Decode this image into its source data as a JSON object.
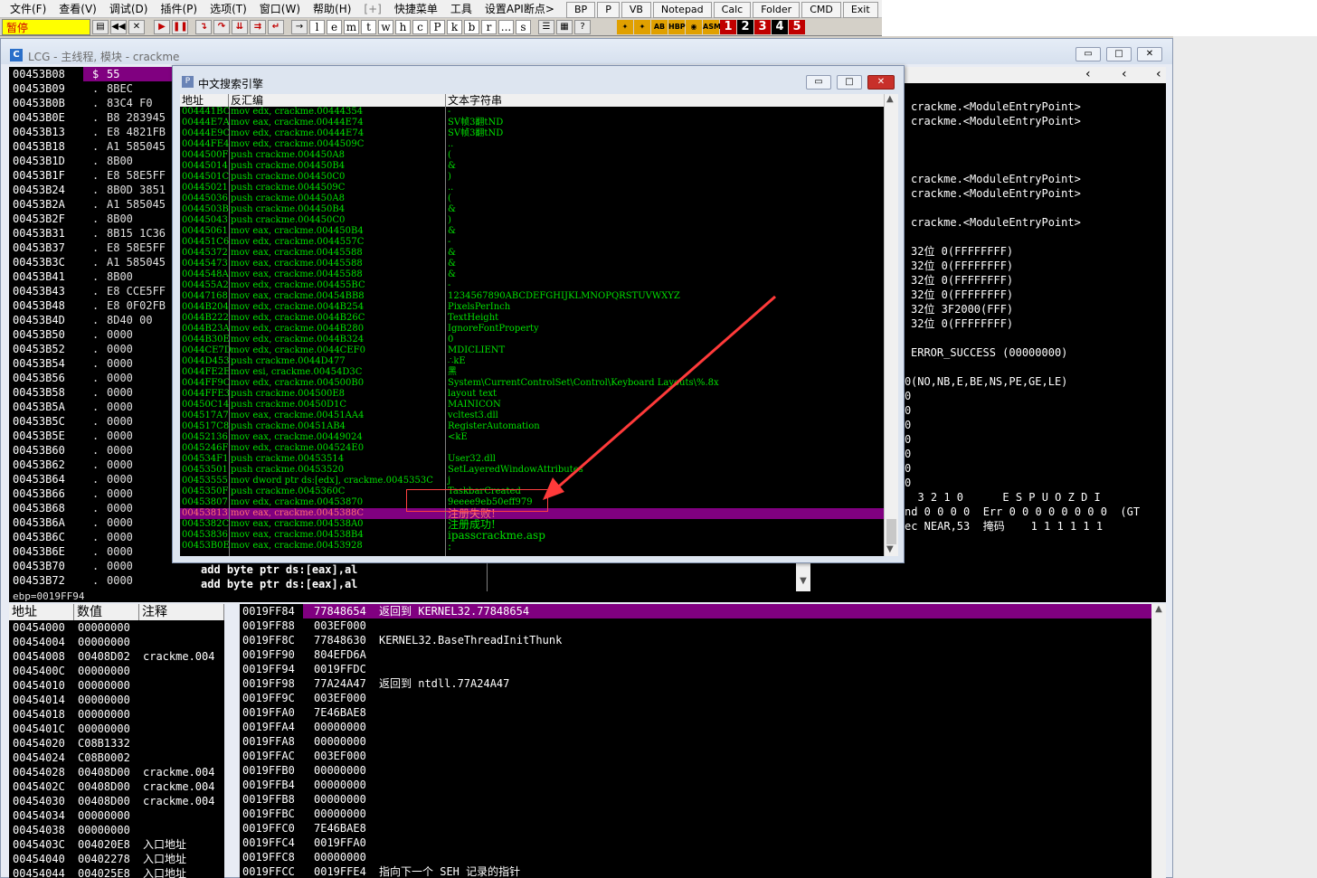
{
  "menu": [
    "文件(F)",
    "查看(V)",
    "调试(D)",
    "插件(P)",
    "选项(T)",
    "窗口(W)",
    "帮助(H)",
    "[+]",
    "快捷菜单",
    "工具",
    "设置API断点>"
  ],
  "plugins": [
    "BP",
    "P",
    "VB",
    "Notepad",
    "Calc",
    "Folder",
    "CMD",
    "Exit"
  ],
  "toolbar": {
    "pause": "暂停",
    "letters": [
      "l",
      "e",
      "m",
      "t",
      "w",
      "h",
      "c",
      "P",
      "k",
      "b",
      "r",
      "...",
      "s"
    ],
    "numbers": [
      "1",
      "2",
      "3",
      "4",
      "5"
    ]
  },
  "cpu": {
    "icon": "C",
    "title": "LCG - 主线程, 模块 - crackme"
  },
  "disasm": {
    "rows": [
      [
        "00453B08",
        "$",
        "55"
      ],
      [
        "00453B09",
        ".",
        "8BEC"
      ],
      [
        "00453B0B",
        ".",
        "83C4 F0"
      ],
      [
        "00453B0E",
        ".",
        "B8 283945"
      ],
      [
        "00453B13",
        ".",
        "E8 4821FB"
      ],
      [
        "00453B18",
        ".",
        "A1 585045"
      ],
      [
        "00453B1D",
        ".",
        "8B00"
      ],
      [
        "00453B1F",
        ".",
        "E8 58E5FF"
      ],
      [
        "00453B24",
        ".",
        "8B0D 3851"
      ],
      [
        "00453B2A",
        ".",
        "A1 585045"
      ],
      [
        "00453B2F",
        ".",
        "8B00"
      ],
      [
        "00453B31",
        ".",
        "8B15 1C36"
      ],
      [
        "00453B37",
        ".",
        "E8 58E5FF"
      ],
      [
        "00453B3C",
        ".",
        "A1 585045"
      ],
      [
        "00453B41",
        ".",
        "8B00"
      ],
      [
        "00453B43",
        ".",
        "E8 CCE5FF"
      ],
      [
        "00453B48",
        ".",
        "E8 0F02FB"
      ],
      [
        "00453B4D",
        ".",
        "8D40 00"
      ],
      [
        "00453B50",
        ".",
        "0000"
      ],
      [
        "00453B52",
        ".",
        "0000"
      ],
      [
        "00453B54",
        ".",
        "0000"
      ],
      [
        "00453B56",
        ".",
        "0000"
      ],
      [
        "00453B58",
        ".",
        "0000"
      ],
      [
        "00453B5A",
        ".",
        "0000"
      ],
      [
        "00453B5C",
        ".",
        "0000"
      ],
      [
        "00453B5E",
        ".",
        "0000"
      ],
      [
        "00453B60",
        ".",
        "0000"
      ],
      [
        "00453B62",
        ".",
        "0000"
      ],
      [
        "00453B64",
        ".",
        "0000"
      ],
      [
        "00453B66",
        ".",
        "0000"
      ],
      [
        "00453B68",
        ".",
        "0000"
      ],
      [
        "00453B6A",
        ".",
        "0000"
      ],
      [
        "00453B6C",
        ".",
        "0000"
      ],
      [
        "00453B6E",
        ".",
        "0000"
      ],
      [
        "00453B70",
        ".",
        "0000"
      ],
      [
        "00453B72",
        ".",
        "0000"
      ]
    ],
    "asm_tail": [
      "add byte ptr ds:[eax],al",
      "add byte ptr ds:[eax],al"
    ],
    "info": "ebp=0019FF94"
  },
  "registers": {
    "lines": [
      "crackme.<ModuleEntryPoint>",
      "crackme.<ModuleEntryPoint>",
      "",
      "",
      "",
      "crackme.<ModuleEntryPoint>",
      "crackme.<ModuleEntryPoint>",
      "",
      "crackme.<ModuleEntryPoint>",
      "",
      "32位 0(FFFFFFFF)",
      "32位 0(FFFFFFFF)",
      "32位 0(FFFFFFFF)",
      "32位 0(FFFFFFFF)",
      "32位 3F2000(FFF)",
      "32位 0(FFFFFFFF)",
      "",
      "ERROR_SUCCESS (00000000)",
      "",
      "(NO,NB,E,BE,NS,PE,GE,LE)"
    ],
    "zeros": [
      "0",
      "0",
      "0",
      "0",
      "0",
      "0",
      "0",
      "0"
    ],
    "fpu1": "  3 2 1 0      E S P U O Z D I",
    "fpu2": "nd 0 0 0 0  Err 0 0 0 0 0 0 0 0  (GT",
    "fpu3": "ec NEAR,53  掩码    1 1 1 1 1 1"
  },
  "dialog": {
    "icon": "P",
    "title": "中文搜索引擎",
    "headers": [
      "地址",
      "反汇编",
      "文本字符串"
    ],
    "rows": [
      [
        "004441BC",
        "mov edx, crackme.00444354",
        "-"
      ],
      [
        "00444E7A",
        "mov eax, crackme.00444E74",
        "SV帧3翻tND"
      ],
      [
        "00444E9C",
        "mov edx, crackme.00444E74",
        "SV帧3翻tND"
      ],
      [
        "00444FE4",
        "mov edx, crackme.0044509C",
        ".."
      ],
      [
        "0044500F",
        "push crackme.004450A8",
        "("
      ],
      [
        "00445014",
        "push crackme.004450B4",
        "&"
      ],
      [
        "0044501C",
        "push crackme.004450C0",
        ")"
      ],
      [
        "00445021",
        "push crackme.0044509C",
        ".."
      ],
      [
        "00445036",
        "push crackme.004450A8",
        "("
      ],
      [
        "0044503B",
        "push crackme.004450B4",
        "&"
      ],
      [
        "00445043",
        "push crackme.004450C0",
        ")"
      ],
      [
        "00445061",
        "mov eax, crackme.004450B4",
        "&"
      ],
      [
        "004451C6",
        "mov edx, crackme.0044557C",
        "-"
      ],
      [
        "00445372",
        "mov eax, crackme.00445588",
        "&"
      ],
      [
        "00445473",
        "mov eax, crackme.00445588",
        "&"
      ],
      [
        "0044548A",
        "mov eax, crackme.00445588",
        "&"
      ],
      [
        "004455A2",
        "mov edx, crackme.004455BC",
        "-"
      ],
      [
        "00447168",
        "mov eax, crackme.00454BB8",
        "1234567890ABCDEFGHIJKLMNOPQRSTUVWXYZ"
      ],
      [
        "0044B204",
        "mov edx, crackme.0044B254",
        "PixelsPerInch"
      ],
      [
        "0044B222",
        "mov edx, crackme.0044B26C",
        "TextHeight"
      ],
      [
        "0044B23A",
        "mov edx, crackme.0044B280",
        "IgnoreFontProperty"
      ],
      [
        "0044B30E",
        "mov edx, crackme.0044B324",
        "0"
      ],
      [
        "0044CE7D",
        "mov edx, crackme.0044CEF0",
        "MDICLIENT"
      ],
      [
        "0044D453",
        "push crackme.0044D477",
        "∴kE"
      ],
      [
        "0044FE2E",
        "mov esi, crackme.00454D3C",
        "黑"
      ],
      [
        "0044FF9C",
        "mov edx, crackme.004500B0",
        "System\\CurrentControlSet\\Control\\Keyboard Layouts\\%.8x"
      ],
      [
        "0044FFE3",
        "push crackme.004500E8",
        "layout text"
      ],
      [
        "00450C14",
        "push crackme.00450D1C",
        "MAINICON"
      ],
      [
        "004517A7",
        "mov eax, crackme.00451AA4",
        "vcltest3.dll"
      ],
      [
        "004517C8",
        "push crackme.00451AB4",
        "RegisterAutomation"
      ],
      [
        "00452136",
        "mov eax, crackme.00449024",
        "<kE"
      ],
      [
        "0045246F",
        "mov edx, crackme.004524E0",
        ""
      ],
      [
        "004534F1",
        "push crackme.00453514",
        "User32.dll"
      ],
      [
        "00453501",
        "push crackme.00453520",
        "SetLayeredWindowAttributes"
      ],
      [
        "00453555",
        "mov dword ptr ds:[edx], crackme.0045353C",
        "j"
      ],
      [
        "0045350F",
        "push crackme.0045360C",
        "TaskbarCreated"
      ],
      [
        "00453807",
        "mov edx, crackme.00453870",
        "9eeee9eb50eff979"
      ],
      [
        "00453813",
        "mov eax, crackme.0045388C",
        "注册失败!"
      ],
      [
        "0045382C",
        "mov eax, crackme.004538A0",
        "注册成功!"
      ],
      [
        "00453836",
        "mov eax, crackme.004538B4",
        "ipasscrackme.asp"
      ],
      [
        "00453B0E",
        "mov eax, crackme.00453928",
        ":"
      ]
    ],
    "selected_index": 37
  },
  "dump": {
    "headers": [
      "地址",
      "数值",
      "注释"
    ],
    "rows": [
      [
        "00454000",
        "00000000",
        ""
      ],
      [
        "00454004",
        "00000000",
        ""
      ],
      [
        "00454008",
        "00408D02",
        "crackme.004"
      ],
      [
        "0045400C",
        "00000000",
        ""
      ],
      [
        "00454010",
        "00000000",
        ""
      ],
      [
        "00454014",
        "00000000",
        ""
      ],
      [
        "00454018",
        "00000000",
        ""
      ],
      [
        "0045401C",
        "00000000",
        ""
      ],
      [
        "00454020",
        "C08B1332",
        ""
      ],
      [
        "00454024",
        "C08B0002",
        ""
      ],
      [
        "00454028",
        "00408D00",
        "crackme.004"
      ],
      [
        "0045402C",
        "00408D00",
        "crackme.004"
      ],
      [
        "00454030",
        "00408D00",
        "crackme.004"
      ],
      [
        "00454034",
        "00000000",
        ""
      ],
      [
        "00454038",
        "00000000",
        ""
      ],
      [
        "0045403C",
        "004020E8",
        "入口地址"
      ],
      [
        "00454040",
        "00402278",
        "入口地址"
      ],
      [
        "00454044",
        "004025E8",
        "入口地址"
      ]
    ]
  },
  "stack": {
    "rows": [
      [
        "0019FF84",
        "77848654",
        "返回到 KERNEL32.77848654"
      ],
      [
        "0019FF88",
        "003EF000",
        ""
      ],
      [
        "0019FF8C",
        "77848630",
        "KERNEL32.BaseThreadInitThunk"
      ],
      [
        "0019FF90",
        "804EFD6A",
        ""
      ],
      [
        "0019FF94",
        "0019FFDC",
        ""
      ],
      [
        "0019FF98",
        "77A24A47",
        "返回到 ntdll.77A24A47"
      ],
      [
        "0019FF9C",
        "003EF000",
        ""
      ],
      [
        "0019FFA0",
        "7E46BAE8",
        ""
      ],
      [
        "0019FFA4",
        "00000000",
        ""
      ],
      [
        "0019FFA8",
        "00000000",
        ""
      ],
      [
        "0019FFAC",
        "003EF000",
        ""
      ],
      [
        "0019FFB0",
        "00000000",
        ""
      ],
      [
        "0019FFB4",
        "00000000",
        ""
      ],
      [
        "0019FFB8",
        "00000000",
        ""
      ],
      [
        "0019FFBC",
        "00000000",
        ""
      ],
      [
        "0019FFC0",
        "7E46BAE8",
        ""
      ],
      [
        "0019FFC4",
        "0019FFA0",
        ""
      ],
      [
        "0019FFC8",
        "00000000",
        ""
      ],
      [
        "0019FFCC",
        "0019FFE4",
        "指向下一个 SEH 记录的指针"
      ]
    ]
  },
  "colors": {
    "selection": "#800080",
    "text_green": "#00e000",
    "pause_bg": "#ffff00",
    "annot": "#ff3030"
  }
}
